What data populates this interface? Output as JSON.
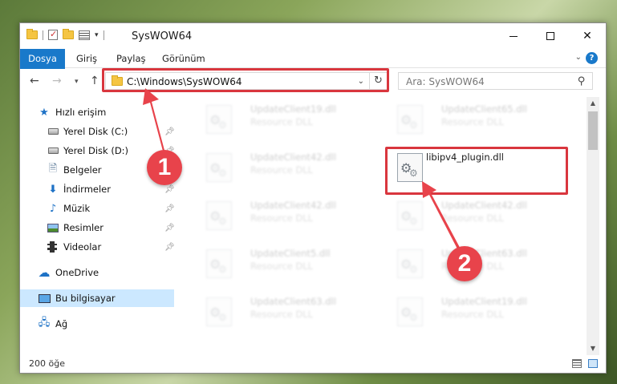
{
  "window": {
    "title": "SysWOW64",
    "controls": {
      "minimize": "minimize",
      "maximize": "maximize",
      "close": "✕"
    }
  },
  "ribbon": {
    "tabs": [
      "Dosya",
      "Giriş",
      "Paylaş",
      "Görünüm"
    ],
    "help": "?"
  },
  "navbar": {
    "address": "C:\\Windows\\SysWOW64",
    "search_placeholder": "Ara: SysWOW64"
  },
  "sidebar": {
    "items": [
      {
        "label": "Hızlı erişim",
        "icon": "star-icon",
        "pinned": false
      },
      {
        "label": "Yerel Disk (C:)",
        "icon": "drive-icon",
        "pinned": true
      },
      {
        "label": "Yerel Disk (D:)",
        "icon": "drive-icon",
        "pinned": true
      },
      {
        "label": "Belgeler",
        "icon": "documents-icon",
        "pinned": true
      },
      {
        "label": "İndirmeler",
        "icon": "downloads-icon",
        "pinned": true
      },
      {
        "label": "Müzik",
        "icon": "music-icon",
        "pinned": true
      },
      {
        "label": "Resimler",
        "icon": "pictures-icon",
        "pinned": true
      },
      {
        "label": "Videolar",
        "icon": "videos-icon",
        "pinned": true
      },
      {
        "label": "OneDrive",
        "icon": "onedrive-icon",
        "pinned": false
      },
      {
        "label": "Bu bilgisayar",
        "icon": "this-pc-icon",
        "pinned": false,
        "selected": true
      },
      {
        "label": "Ağ",
        "icon": "network-icon",
        "pinned": false
      }
    ]
  },
  "files": [
    {
      "name": "UpdateClient19.dll",
      "desc": "Resource DLL",
      "faded": true
    },
    {
      "name": "UpdateClient65.dll",
      "desc": "Resource DLL",
      "faded": true
    },
    {
      "name": "UpdateClient42.dll",
      "desc": "Resource DLL",
      "faded": true
    },
    {
      "name": "libipv4_plugin.dll",
      "desc": "",
      "faded": false,
      "highlighted": true
    },
    {
      "name": "UpdateClient42.dll",
      "desc": "Resource DLL",
      "faded": true
    },
    {
      "name": "UpdateClient42.dll",
      "desc": "Resource DLL",
      "faded": true
    },
    {
      "name": "UpdateClient5.dll",
      "desc": "Resource DLL",
      "faded": true
    },
    {
      "name": "UpdateClient63.dll",
      "desc": "Resource DLL",
      "faded": true
    },
    {
      "name": "UpdateClient63.dll",
      "desc": "Resource DLL",
      "faded": true
    },
    {
      "name": "UpdateClient19.dll",
      "desc": "Resource DLL",
      "faded": true
    }
  ],
  "status": {
    "count": "200 öğe"
  },
  "annotations": {
    "step1": "1",
    "step2": "2",
    "color": "#e8434b"
  }
}
